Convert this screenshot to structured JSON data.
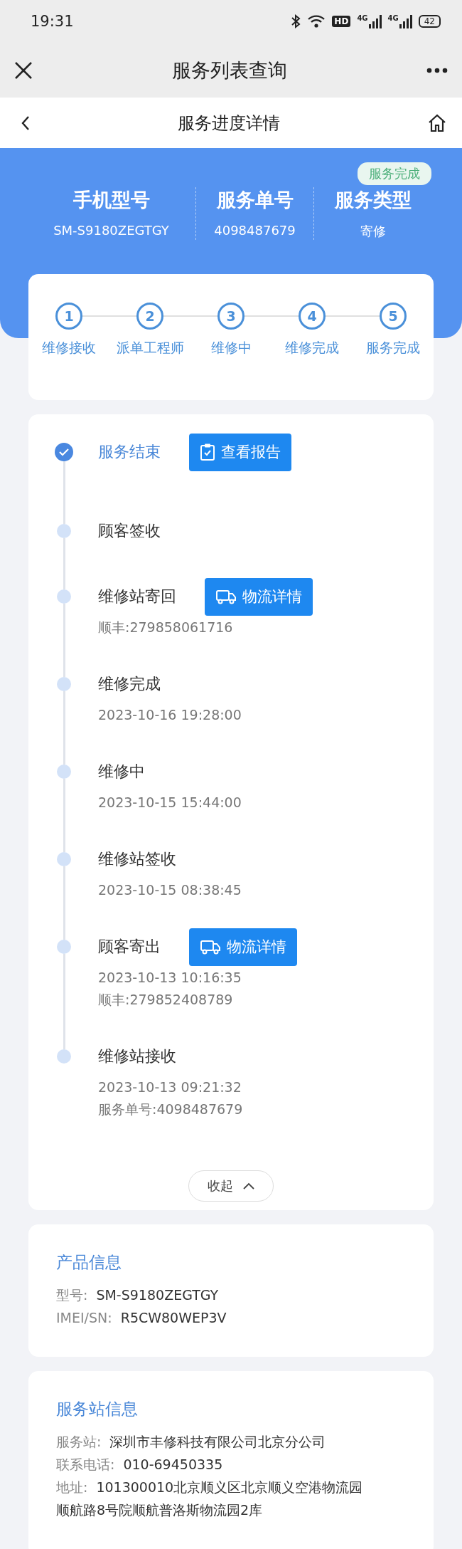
{
  "status_bar": {
    "time": "19:31",
    "hd": "HD",
    "networks": [
      "4G",
      "4G"
    ],
    "battery": "42"
  },
  "window": {
    "title": "服务列表查询"
  },
  "nav": {
    "title": "服务进度详情"
  },
  "header": {
    "badge": "服务完成",
    "columns": [
      {
        "heading": "手机型号",
        "value": "SM-S9180ZEGTGY"
      },
      {
        "heading": "服务单号",
        "value": "4098487679"
      },
      {
        "heading": "服务类型",
        "value": "寄修"
      }
    ]
  },
  "steps": [
    {
      "number": "1",
      "label": "维修接收"
    },
    {
      "number": "2",
      "label": "派单工程师"
    },
    {
      "number": "3",
      "label": "维修中"
    },
    {
      "number": "4",
      "label": "维修完成"
    },
    {
      "number": "5",
      "label": "服务完成"
    }
  ],
  "timeline": {
    "events": [
      {
        "title": "服务结束",
        "active": true,
        "button": {
          "kind": "report",
          "label": "查看报告"
        }
      },
      {
        "title": "顾客签收",
        "active": false
      },
      {
        "title": "维修站寄回",
        "active": false,
        "button": {
          "kind": "logistics",
          "label": "物流详情"
        },
        "details": [
          "顺丰:279858061716"
        ]
      },
      {
        "title": "维修完成",
        "active": false,
        "details": [
          "2023-10-16 19:28:00"
        ]
      },
      {
        "title": "维修中",
        "active": false,
        "details": [
          "2023-10-15 15:44:00"
        ]
      },
      {
        "title": "维修站签收",
        "active": false,
        "details": [
          "2023-10-15 08:38:45"
        ]
      },
      {
        "title": "顾客寄出",
        "active": false,
        "button": {
          "kind": "logistics",
          "label": "物流详情"
        },
        "details": [
          "2023-10-13 10:16:35",
          "顺丰:279852408789"
        ]
      },
      {
        "title": "维修站接收",
        "active": false,
        "details": [
          "2023-10-13 09:21:32",
          "服务单号:4098487679"
        ]
      }
    ],
    "collapse_button": "收起"
  },
  "product_info": {
    "title": "产品信息",
    "fields": [
      {
        "label": "型号:",
        "value": "SM-S9180ZEGTGY"
      },
      {
        "label": "IMEI/SN:",
        "value": "R5CW80WEP3V"
      }
    ]
  },
  "station_info": {
    "title": "服务站信息",
    "fields": [
      {
        "label": "服务站:",
        "value": "深圳市丰修科技有限公司北京分公司"
      },
      {
        "label": "联系电话:",
        "value": "010-69450335"
      },
      {
        "label": "地址:",
        "value": "101300010北京顺义区北京顺义空港物流园顺航路8号院顺航普洛斯物流园2库"
      }
    ]
  }
}
